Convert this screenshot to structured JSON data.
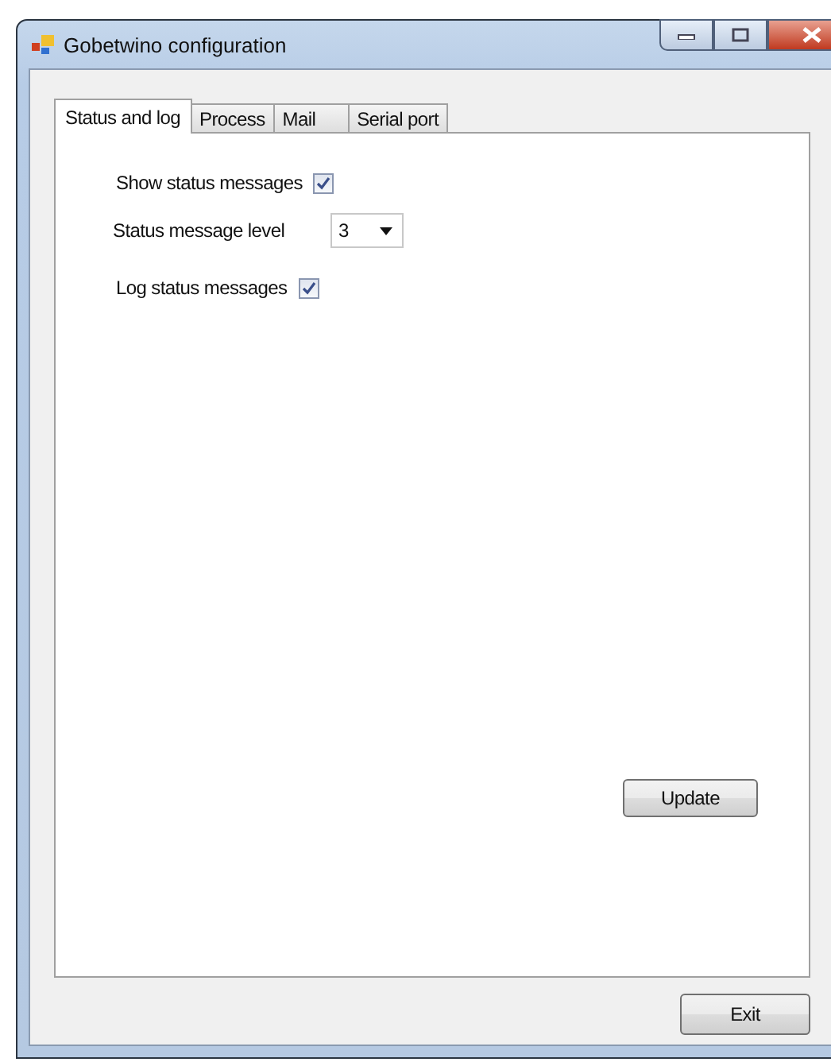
{
  "window": {
    "title": "Gobetwino configuration"
  },
  "tabs": [
    {
      "label": "Status and log",
      "selected": true
    },
    {
      "label": "Process",
      "selected": false
    },
    {
      "label": "Mail",
      "selected": false
    },
    {
      "label": "Serial port",
      "selected": false
    }
  ],
  "settings": [
    {
      "kind": "checkbox",
      "label": "Show status messages",
      "checked": true
    },
    {
      "kind": "dropdown",
      "label": "Status message level",
      "value": "3"
    },
    {
      "kind": "checkbox",
      "label": "Log status messages",
      "checked": true
    }
  ],
  "panel_button": "Update",
  "footer_button": "Exit"
}
